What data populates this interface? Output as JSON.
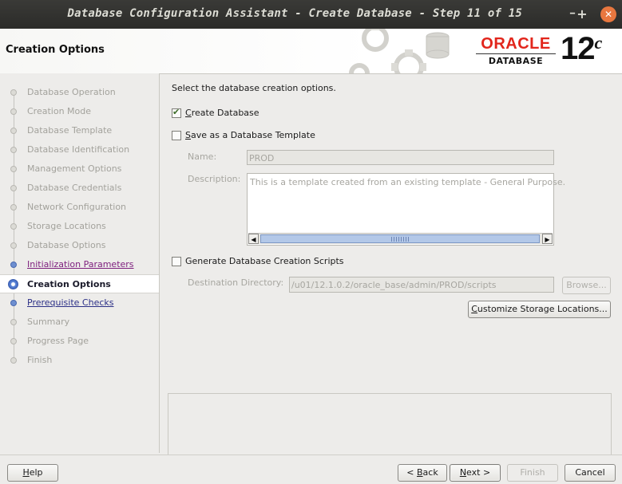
{
  "window": {
    "title": "Database Configuration Assistant - Create Database - Step 11 of 15",
    "minimize_glyph": "━",
    "maximize_glyph": "+",
    "close_glyph": "✕"
  },
  "header": {
    "page_title": "Creation Options",
    "oracle_word": "ORACLE",
    "oracle_sub": "DATABASE",
    "version": "12",
    "version_suffix": "c"
  },
  "sidebar": {
    "steps": [
      {
        "label": "Database Operation",
        "state": "done"
      },
      {
        "label": "Creation Mode",
        "state": "done"
      },
      {
        "label": "Database Template",
        "state": "done"
      },
      {
        "label": "Database Identification",
        "state": "done"
      },
      {
        "label": "Management Options",
        "state": "done"
      },
      {
        "label": "Database Credentials",
        "state": "done"
      },
      {
        "label": "Network Configuration",
        "state": "done"
      },
      {
        "label": "Storage Locations",
        "state": "done"
      },
      {
        "label": "Database Options",
        "state": "done"
      },
      {
        "label": "Initialization Parameters",
        "state": "link-visited"
      },
      {
        "label": "Creation Options",
        "state": "current"
      },
      {
        "label": "Prerequisite Checks",
        "state": "link"
      },
      {
        "label": "Summary",
        "state": "pending"
      },
      {
        "label": "Progress Page",
        "state": "pending"
      },
      {
        "label": "Finish",
        "state": "pending"
      }
    ]
  },
  "main": {
    "instruction": "Select the database creation options.",
    "create_db_label": "Create Database",
    "create_db_checked": true,
    "save_template_label": "Save as a Database Template",
    "save_template_checked": false,
    "name_label": "Name:",
    "name_value": "PROD",
    "description_label": "Description:",
    "description_value": "This is a template created from an existing template - General Purpose.",
    "gen_scripts_label": "Generate Database Creation Scripts",
    "gen_scripts_checked": false,
    "dest_dir_label": "Destination Directory:",
    "dest_dir_value": "/u01/12.1.0.2/oracle_base/admin/PROD/scripts",
    "browse_label": "Browse...",
    "customize_label": "Customize Storage Locations..."
  },
  "footer": {
    "help": "Help",
    "back": "< Back",
    "next": "Next >",
    "finish": "Finish",
    "cancel": "Cancel"
  },
  "colors": {
    "oracle_red": "#e2261c",
    "link": "#2b2f86",
    "visited_link": "#7d1d7d",
    "close_button": "#e8773f"
  }
}
